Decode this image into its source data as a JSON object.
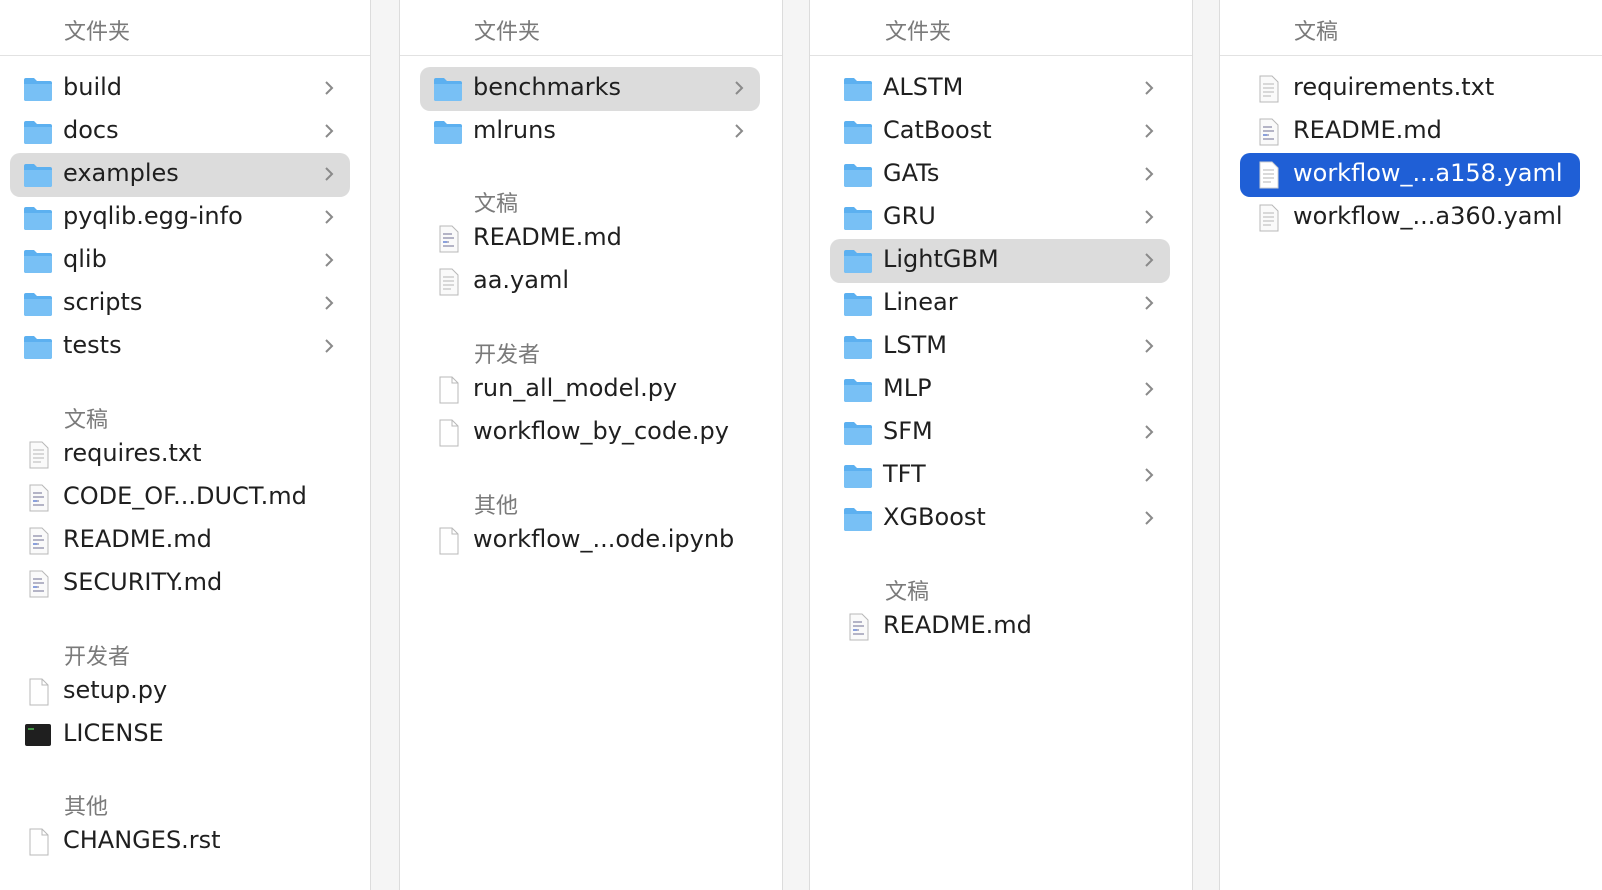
{
  "columns": [
    {
      "header": "文件夹",
      "folders": [
        "build",
        "docs",
        "examples",
        "pyqlib.egg-info",
        "qlib",
        "scripts",
        "tests"
      ],
      "selected_folder": "examples",
      "sections": [
        {
          "title": "文稿",
          "files": [
            "requires.txt",
            "CODE_OF...DUCT.md",
            "README.md",
            "SECURITY.md"
          ]
        },
        {
          "title": "开发者",
          "files": [
            "setup.py",
            "LICENSE"
          ]
        },
        {
          "title": "其他",
          "files": [
            "CHANGES.rst"
          ]
        }
      ]
    },
    {
      "header": "文件夹",
      "folders": [
        "benchmarks",
        "mlruns"
      ],
      "selected_folder": "benchmarks",
      "sections": [
        {
          "title": "文稿",
          "files": [
            "README.md",
            "aa.yaml"
          ]
        },
        {
          "title": "开发者",
          "files": [
            "run_all_model.py",
            "workflow_by_code.py"
          ]
        },
        {
          "title": "其他",
          "files": [
            "workflow_...ode.ipynb"
          ]
        }
      ]
    },
    {
      "header": "文件夹",
      "folders": [
        "ALSTM",
        "CatBoost",
        "GATs",
        "GRU",
        "LightGBM",
        "Linear",
        "LSTM",
        "MLP",
        "SFM",
        "TFT",
        "XGBoost"
      ],
      "selected_folder": "LightGBM",
      "sections": [
        {
          "title": "文稿",
          "files": [
            "README.md"
          ]
        }
      ]
    },
    {
      "header": "文稿",
      "files": [
        "requirements.txt",
        "README.md",
        "workflow_...a158.yaml",
        "workflow_...a360.yaml"
      ],
      "selected_file": "workflow_...a158.yaml"
    }
  ],
  "colors": {
    "selection_active": "#1f5fd6",
    "selection_inactive": "#dcdcdc",
    "folder_icon": "#5cb0f0"
  }
}
